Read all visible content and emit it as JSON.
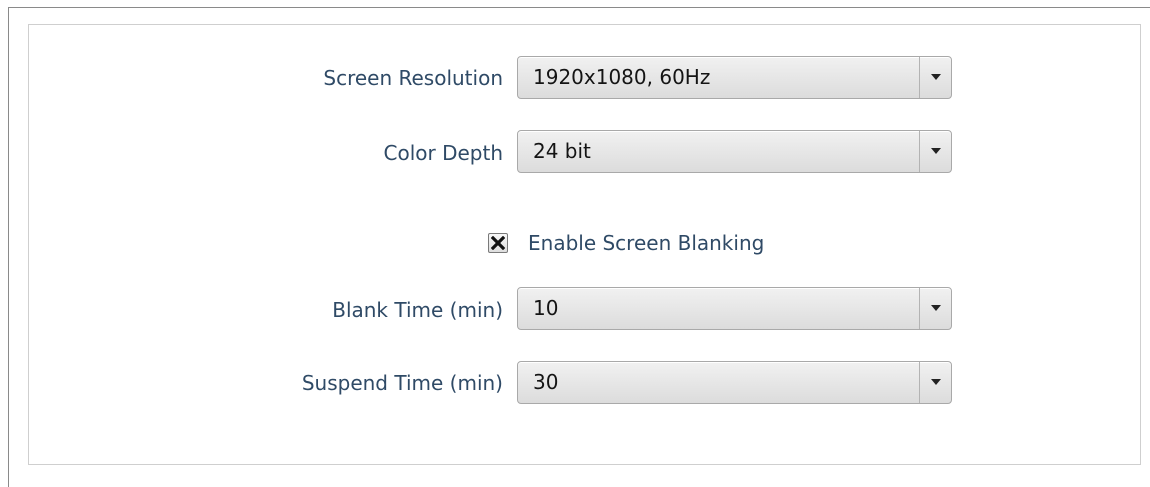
{
  "settings": {
    "screen_resolution": {
      "label": "Screen Resolution",
      "value": "1920x1080, 60Hz"
    },
    "color_depth": {
      "label": "Color Depth",
      "value": "24 bit"
    },
    "screen_blanking": {
      "label": "Enable Screen Blanking",
      "checked": true
    },
    "blank_time": {
      "label": "Blank Time (min)",
      "value": "10"
    },
    "suspend_time": {
      "label": "Suspend Time (min)",
      "value": "30"
    }
  },
  "icons": {
    "dropdown": "chevron-down-icon",
    "checkbox_mark": "x-mark-icon"
  }
}
